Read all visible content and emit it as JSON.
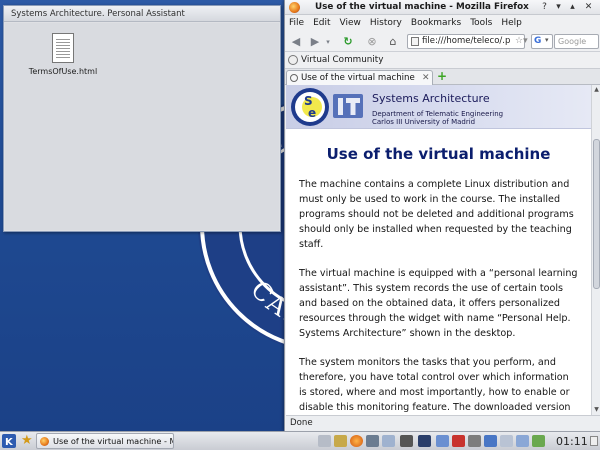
{
  "desktop": {
    "window_title": "Systems Architecture. Personal Assistant",
    "file_label": "TermsOfUse.html",
    "seal_text": "UNIVERSIDAD CARLOS III"
  },
  "firefox": {
    "title": "Use of the virtual machine - Mozilla Firefox",
    "window_buttons": [
      "?",
      "▾",
      "▴",
      "✕"
    ],
    "menu": [
      "File",
      "Edit",
      "View",
      "History",
      "Bookmarks",
      "Tools",
      "Help"
    ],
    "url": "file:///home/teleco/.p",
    "search_placeholder": "Google",
    "bookmark": "Virtual Community",
    "tab_label": "Use of the virtual machine",
    "status": "Done"
  },
  "page": {
    "banner_title": "Systems Architecture",
    "banner_dept": "Department of Telematic Engineering",
    "banner_univ": "Carlos III University of Madrid",
    "heading": "Use of the virtual machine",
    "paragraphs": [
      "The machine contains a complete Linux distribution and must only be used to work in the course. The installed programs should not be deleted and additional programs should only be installed when requested by the teaching staff.",
      "The virtual machine is equipped with a “personal learning assistant”. This system records the use of certain tools and based on the obtained data, it offers personalized resources through the widget with name “Personal Help. Systems Architecture” shown in the desktop.",
      "The system monitors the tasks that you perform, and therefore, you have total control over which information is stored, where and most importantly, how to enable or disable this monitoring feature. The downloaded version of this virtual machine contains this monitoring system enabled. In the following section we explain briefly which"
    ]
  },
  "taskbar": {
    "task_label": "Use of the virtual machine - Mozilla F",
    "clock": "01:11"
  },
  "colors": {
    "desktop_blue": "#23458e",
    "heading_navy": "#0b1e6e"
  }
}
